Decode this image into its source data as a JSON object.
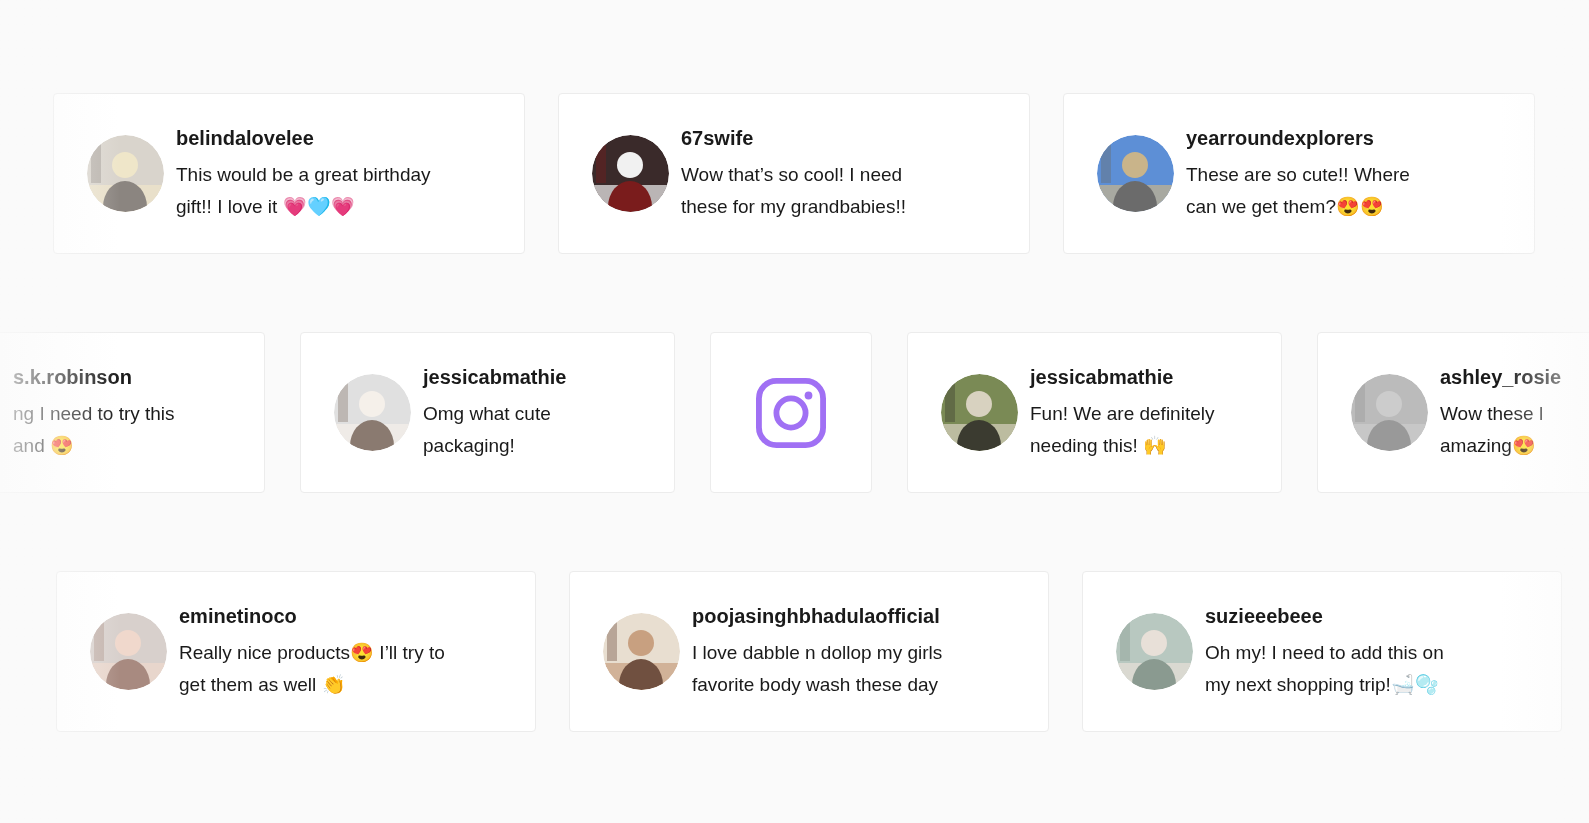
{
  "rows": [
    {
      "cards": [
        {
          "kind": "comment",
          "username": "belindalovelee",
          "comment": "This would be a great birthday\ngift!! I love it 💗🩵💗"
        },
        {
          "kind": "comment",
          "username": "67swife",
          "comment": "Wow that’s so cool! I need\nthese for my grandbabies!!"
        },
        {
          "kind": "comment",
          "username": "yearroundexplorers",
          "comment": "These are so cute!! Where\ncan we get them?😍😍"
        }
      ]
    },
    {
      "cards": [
        {
          "kind": "comment_cut",
          "username": "s.k.robinson",
          "comment": "ng I need to try this\nand 😍"
        },
        {
          "kind": "comment",
          "username": "jessicabmathie",
          "comment": "Omg what cute\npackaging!"
        },
        {
          "kind": "instagram"
        },
        {
          "kind": "comment",
          "username": "jessicabmathie",
          "comment": "Fun! We are definitely\nneeding this! 🙌"
        },
        {
          "kind": "comment",
          "username": "ashley_rosie",
          "comment": "Wow these l\namazing😍"
        }
      ]
    },
    {
      "cards": [
        {
          "kind": "comment",
          "username": "eminetinoco",
          "comment": "Really nice products😍 I’ll try to\nget them as well 👏"
        },
        {
          "kind": "comment",
          "username": "poojasinghbhadulaofficial",
          "comment": "I love dabble n dollop my girls\nfavorite body wash these day"
        },
        {
          "kind": "comment",
          "username": "suzieeebeee",
          "comment": "Oh my! I need to add this on\nmy next shopping trip!🛁🫧"
        }
      ]
    }
  ]
}
